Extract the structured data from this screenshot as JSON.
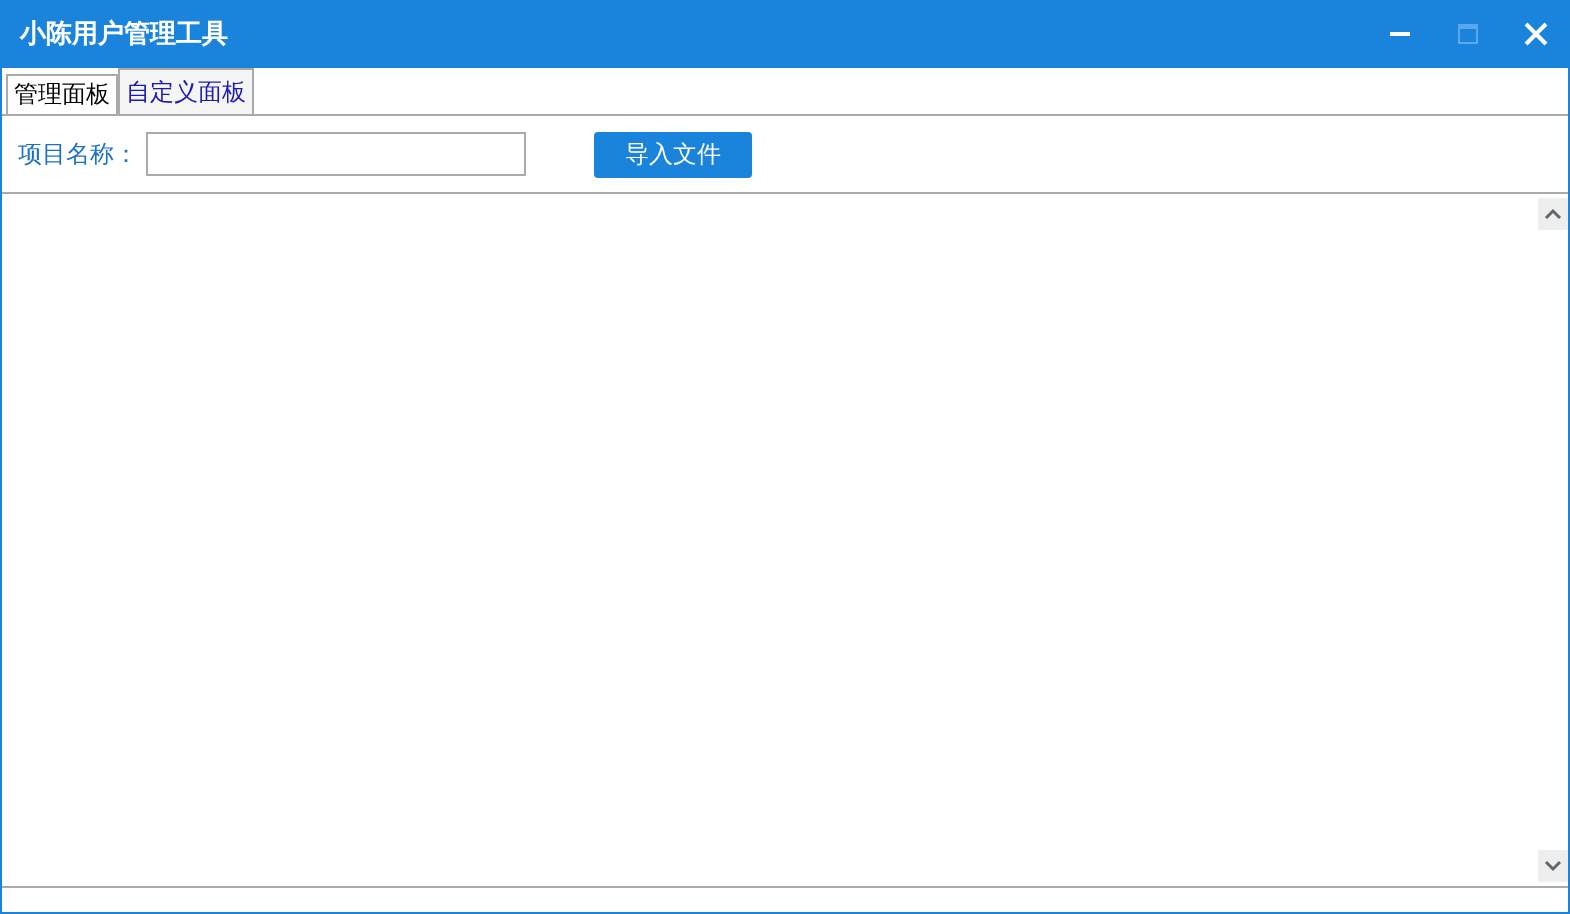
{
  "window": {
    "title": "小陈用户管理工具",
    "controls": [
      {
        "kind": "minimize",
        "disabled": false
      },
      {
        "kind": "maximize",
        "disabled": true
      },
      {
        "kind": "close",
        "disabled": false
      }
    ]
  },
  "tabs": [
    {
      "label": "管理面板",
      "selected": false
    },
    {
      "label": "自定义面板",
      "selected": true
    }
  ],
  "project_name": {
    "label": "项目名称："
  },
  "import_button": {
    "label": "导入文件"
  }
}
